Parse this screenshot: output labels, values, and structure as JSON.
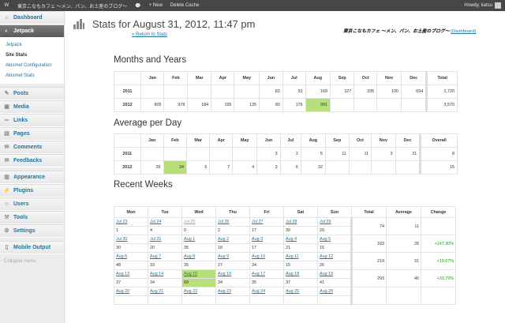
{
  "adminbar": {
    "site_name": "東京こなもカフェ 〜メン、パン、お土産のブログ〜",
    "new_label": "+ New",
    "delete_cache_label": "Delete Cache",
    "howdy": "Howdy, katsu"
  },
  "menu": {
    "items": [
      {
        "label": "Dashboard",
        "icon": "dashboard-icon",
        "glyph": "⌂"
      },
      {
        "label": "Jetpack",
        "icon": "jetpack-icon",
        "glyph": "◐",
        "active": true
      },
      {
        "label": "Posts",
        "icon": "posts-icon",
        "glyph": "✎"
      },
      {
        "label": "Media",
        "icon": "media-icon",
        "glyph": "▣"
      },
      {
        "label": "Links",
        "icon": "links-icon",
        "glyph": "∞"
      },
      {
        "label": "Pages",
        "icon": "pages-icon",
        "glyph": "▤"
      },
      {
        "label": "Comments",
        "icon": "comments-icon",
        "glyph": "✉"
      },
      {
        "label": "Feedbacks",
        "icon": "feedbacks-icon",
        "glyph": "✉"
      },
      {
        "label": "Appearance",
        "icon": "appearance-icon",
        "glyph": "▥"
      },
      {
        "label": "Plugins",
        "icon": "plugins-icon",
        "glyph": "⚡"
      },
      {
        "label": "Users",
        "icon": "users-icon",
        "glyph": "☺"
      },
      {
        "label": "Tools",
        "icon": "tools-icon",
        "glyph": "⚒"
      },
      {
        "label": "Settings",
        "icon": "settings-icon",
        "glyph": "⚙"
      },
      {
        "label": "Mobile Output",
        "icon": "mobile-icon",
        "glyph": "▯"
      }
    ],
    "submenu": [
      "Jetpack",
      "Site Stats",
      "Akismet Configuration",
      "Akismet Stats"
    ],
    "collapse": "Collapse menu"
  },
  "page": {
    "title": "Stats for August 31, 2012, 11:47 pm",
    "back": "« Return to Stats",
    "blog": "東京こなもカフェ 〜メン、パン、お土産のブログ〜",
    "dashboard": "(Dashboard)"
  },
  "months": {
    "heading": "Months and Years",
    "headers": [
      "",
      "Jan",
      "Feb",
      "Mar",
      "Apr",
      "May",
      "Jun",
      "Jul",
      "Aug",
      "Sep",
      "Oct",
      "Nov",
      "Dec",
      "Total"
    ],
    "rows": [
      {
        "year": "2011",
        "cells": [
          "",
          "",
          "",
          "",
          "",
          "83",
          "53",
          "169",
          "327",
          "335",
          "100",
          "654",
          "1,720"
        ]
      },
      {
        "year": "2012",
        "cells": [
          "805",
          "978",
          "184",
          "195",
          "135",
          "90",
          "176",
          "991",
          "",
          "",
          "",
          "",
          "3,570"
        ],
        "hl": 7
      }
    ]
  },
  "average": {
    "heading": "Average per Day",
    "headers": [
      "",
      "Jan",
      "Feb",
      "Mar",
      "Apr",
      "May",
      "Jun",
      "Jul",
      "Aug",
      "Sep",
      "Oct",
      "Nov",
      "Dec",
      "Overall"
    ],
    "rows": [
      {
        "year": "2011",
        "cells": [
          "",
          "",
          "",
          "",
          "",
          "3",
          "2",
          "5",
          "11",
          "11",
          "3",
          "21",
          "8"
        ]
      },
      {
        "year": "2012",
        "cells": [
          "26",
          "34",
          "6",
          "7",
          "4",
          "3",
          "6",
          "32",
          "",
          "",
          "",
          "",
          "15"
        ],
        "hl": 1
      }
    ]
  },
  "weeks": {
    "heading": "Recent Weeks",
    "headers": [
      "Mon",
      "Tue",
      "Wed",
      "Thu",
      "Fri",
      "Sat",
      "Sun",
      "Total",
      "Average",
      "Change"
    ],
    "rows": [
      {
        "dates": [
          "Jul 23",
          "Jul 24",
          "Jul 25",
          "Jul 26",
          "Jul 27",
          "Jul 28",
          "Jul 29"
        ],
        "views": [
          "1",
          "4",
          "0",
          "2",
          "17",
          "30",
          "20"
        ],
        "total": "74",
        "avg": "11",
        "change": ""
      },
      {
        "dates": [
          "Jul 30",
          "Jul 31",
          "Aug 1",
          "Aug 2",
          "Aug 3",
          "Aug 4",
          "Aug 5"
        ],
        "views": [
          "30",
          "20",
          "35",
          "18",
          "17",
          "21",
          "15"
        ],
        "total": "183",
        "avg": "26",
        "change": "+147.30%"
      },
      {
        "dates": [
          "Aug 6",
          "Aug 7",
          "Aug 8",
          "Aug 9",
          "Aug 10",
          "Aug 11",
          "Aug 12"
        ],
        "views": [
          "48",
          "33",
          "35",
          "27",
          "34",
          "15",
          "26"
        ],
        "total": "219",
        "avg": "31",
        "change": "+19.67%"
      },
      {
        "dates": [
          "Aug 13",
          "Aug 14",
          "Aug 15",
          "Aug 16",
          "Aug 17",
          "Aug 18",
          "Aug 19"
        ],
        "views": [
          "37",
          "34",
          "68",
          "34",
          "35",
          "37",
          "41"
        ],
        "total": "293",
        "avg": "40",
        "change": "+33.79%"
      },
      {
        "dates": [
          "Aug 20",
          "Aug 21",
          "Aug 22",
          "Aug 23",
          "Aug 24",
          "Aug 25",
          "Aug 26"
        ],
        "views": [
          "",
          "",
          "",
          "",
          "",
          "",
          ""
        ],
        "total": "",
        "avg": "",
        "change": ""
      }
    ]
  }
}
